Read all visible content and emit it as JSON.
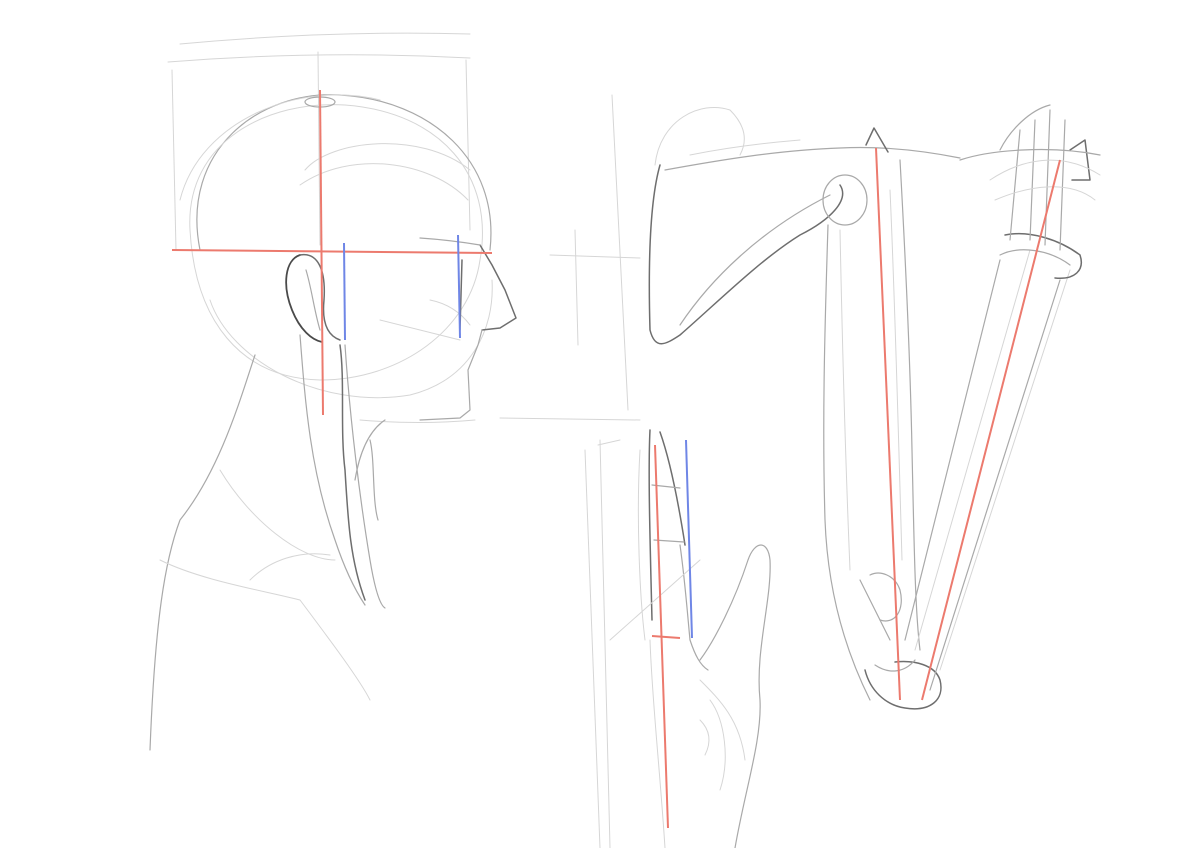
{
  "canvas": {
    "background": "#ffffff"
  },
  "colors": {
    "pencil_light": "#d6d6d6",
    "pencil_mid": "#a9a9a9",
    "pencil_dark": "#6e6e6e",
    "pencil_ink": "#4a4a4a",
    "construction_red": "#ec7a6e",
    "construction_blue": "#6f86e6"
  },
  "subjects": [
    "head-profile",
    "hand",
    "arm"
  ]
}
